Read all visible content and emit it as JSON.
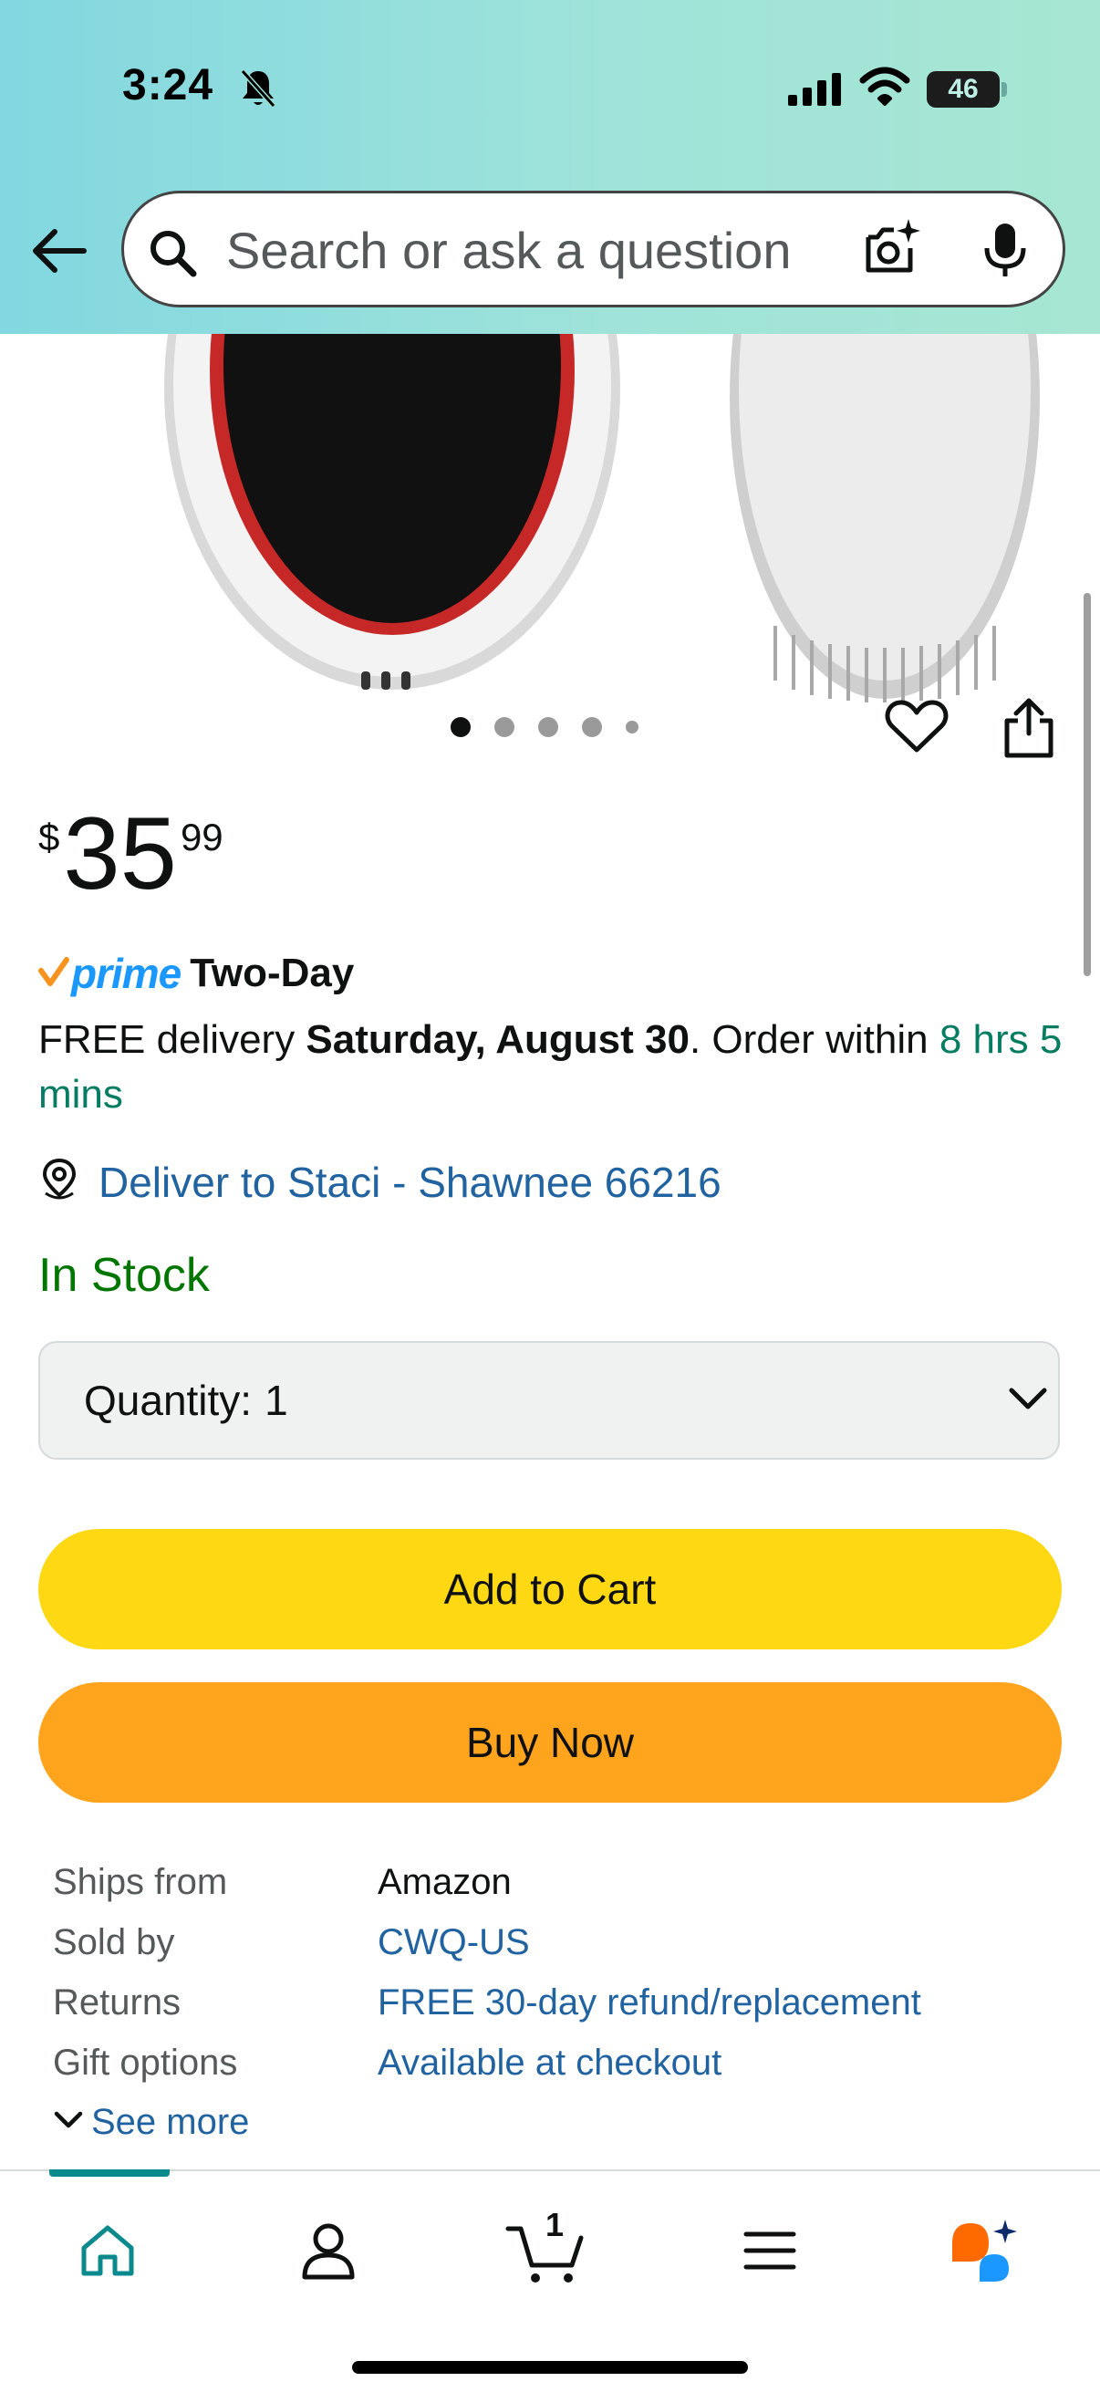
{
  "status_bar": {
    "time": "3:24",
    "battery": "46"
  },
  "search": {
    "placeholder": "Search or ask a question"
  },
  "gallery": {
    "image_count": 5,
    "active_index": 0
  },
  "price": {
    "symbol": "$",
    "whole": "35",
    "fraction": "99"
  },
  "prime": {
    "logo_text": "prime",
    "label": "Two-Day"
  },
  "delivery": {
    "prefix": "FREE delivery ",
    "date": "Saturday, August 30",
    "middle": ". Order within ",
    "countdown": "8 hrs 5 mins"
  },
  "deliver_to": "Deliver to Staci - Shawnee 66216",
  "stock_status": "In Stock",
  "quantity": {
    "label": "Quantity:",
    "value": "1"
  },
  "buttons": {
    "add_to_cart": "Add to Cart",
    "buy_now": "Buy Now"
  },
  "info_rows": [
    {
      "key": "Ships from",
      "value": "Amazon"
    },
    {
      "key": "Sold by",
      "value": "CWQ-US"
    },
    {
      "key": "Returns",
      "value": "FREE 30-day refund/replacement"
    },
    {
      "key": "Gift options",
      "value": "Available at checkout"
    }
  ],
  "see_more": "See more",
  "bottom_nav": {
    "cart_count": "1"
  },
  "colors": {
    "link": "#2162a1",
    "stock_green": "#007600",
    "countdown_green": "#067D62",
    "add_to_cart": "#FFD814",
    "buy_now": "#FFA41C",
    "prime_blue": "#1a98ff",
    "prime_check": "#f7931e"
  }
}
